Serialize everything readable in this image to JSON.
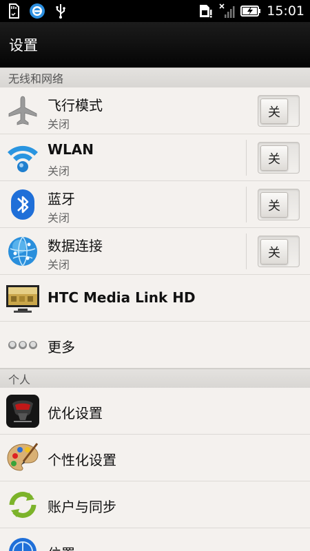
{
  "status_bar": {
    "time": "15:01",
    "left_icons": [
      "sd-card-icon",
      "browser-icon",
      "usb-icon"
    ],
    "right_icons": [
      "sim-card-icon",
      "signal-icon",
      "battery-charging-icon"
    ]
  },
  "header": {
    "title": "设置"
  },
  "sections": {
    "network": {
      "label": "无线和网络"
    },
    "personal": {
      "label": "个人"
    }
  },
  "network_items": [
    {
      "name": "airplane-mode",
      "title": "飞行模式",
      "status": "关闭",
      "toggle": "关",
      "icon": "airplane-icon"
    },
    {
      "name": "wlan",
      "title": "WLAN",
      "status": "关闭",
      "toggle": "关",
      "icon": "wifi-icon"
    },
    {
      "name": "bluetooth",
      "title": "蓝牙",
      "status": "关闭",
      "toggle": "关",
      "icon": "bluetooth-icon"
    },
    {
      "name": "mobile-data",
      "title": "数据连接",
      "status": "关闭",
      "toggle": "关",
      "icon": "globe-icon"
    },
    {
      "name": "htc-media-link",
      "title": "HTC Media Link HD",
      "icon": "tv-icon"
    },
    {
      "name": "more",
      "title": "更多",
      "icon": "more-dots-icon"
    }
  ],
  "personal_items": [
    {
      "name": "optimize",
      "title": "优化设置",
      "icon": "optimize-icon"
    },
    {
      "name": "personalize",
      "title": "个性化设置",
      "icon": "palette-icon"
    },
    {
      "name": "accounts-sync",
      "title": "账户与同步",
      "icon": "sync-icon"
    },
    {
      "name": "location",
      "title": "位置",
      "icon": "location-globe-icon"
    }
  ],
  "colors": {
    "status_bar": "#000000",
    "title_bar": "#111111",
    "list_background": "#f4f1ee",
    "section_header": "#dddbd8",
    "wifi_blue": "#1e88d6",
    "bluetooth_blue": "#1b6fd6",
    "sync_green": "#7cb32a"
  }
}
